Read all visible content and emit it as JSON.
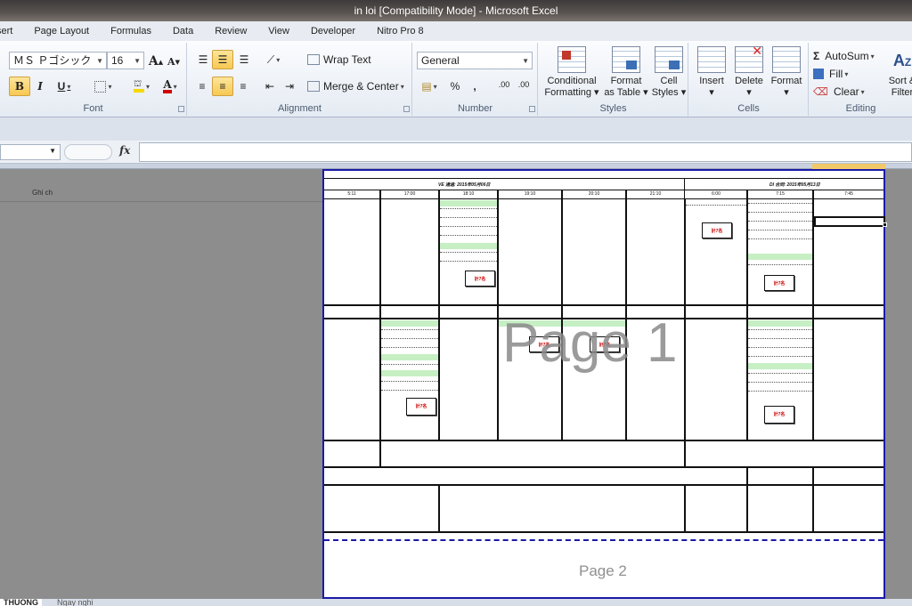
{
  "window": {
    "title": "in loi  [Compatibility Mode]  -  Microsoft Excel"
  },
  "ribbon_tabs": [
    "sert",
    "Page Layout",
    "Formulas",
    "Data",
    "Review",
    "View",
    "Developer",
    "Nitro Pro 8"
  ],
  "font_group": {
    "font_name": "ＭＳ Ｐゴシック",
    "font_size": "16",
    "grow": "A",
    "shrink": "A",
    "bold": "B",
    "italic": "I",
    "underline": "U",
    "font_color_letter": "A",
    "label": "Font"
  },
  "alignment_group": {
    "wrap_text": "Wrap Text",
    "merge_center": "Merge & Center",
    "label": "Alignment"
  },
  "number_group": {
    "format": "General",
    "percent": "%",
    "comma": ",",
    "inc_decimal": ".00",
    "dec_decimal": ".00",
    "label": "Number"
  },
  "styles_group": {
    "conditional_1": "Conditional",
    "conditional_2": "Formatting",
    "format_table_1": "Format",
    "format_table_2": "as Table",
    "cell_styles_1": "Cell",
    "cell_styles_2": "Styles",
    "label": "Styles"
  },
  "cells_group": {
    "insert": "Insert",
    "delete": "Delete",
    "format": "Format",
    "label": "Cells"
  },
  "editing_group": {
    "autosum": "AutoSum",
    "fill": "Fill",
    "clear": "Clear",
    "sort_1": "Sort &",
    "sort_2": "Filter",
    "label": "Editing"
  },
  "formula_bar": {
    "fx": "fx",
    "value": ""
  },
  "sheet": {
    "row_header_text": "Ghi ch",
    "header_left": "VE   通過:  2015年05月06日",
    "header_right": "DI   合同:  2015年05月13日",
    "times": [
      "5:11",
      "17:00",
      "18:10",
      "19:10",
      "20:10",
      "21:10",
      "6:00",
      "7:15",
      "7:45"
    ],
    "seat_label": "計7名",
    "watermark_page1": "Page 1",
    "watermark_page2": "Page 2"
  },
  "sheet_tabs": [
    "THUONG",
    "Ngay nghi"
  ]
}
